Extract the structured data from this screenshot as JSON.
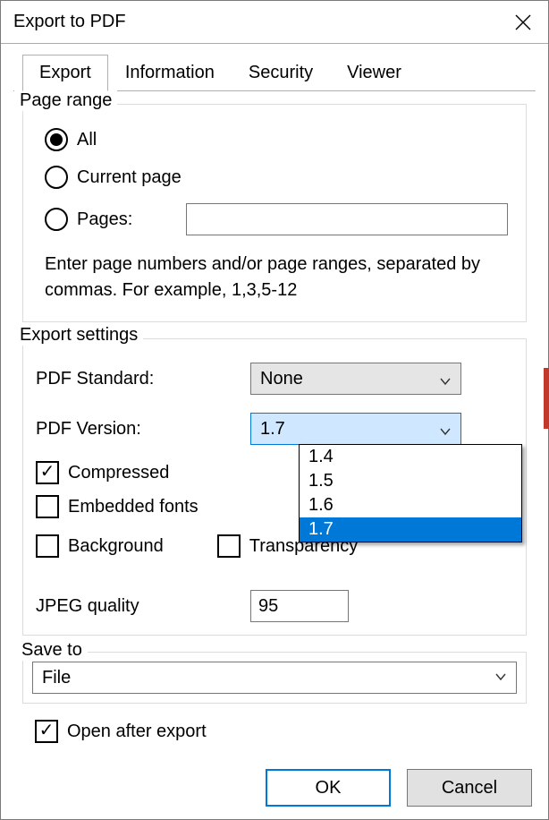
{
  "title": "Export to PDF",
  "tabs": [
    "Export",
    "Information",
    "Security",
    "Viewer"
  ],
  "activeTab": 0,
  "pageRange": {
    "title": "Page range",
    "options": {
      "all": "All",
      "current": "Current page",
      "pages": "Pages:"
    },
    "selected": "all",
    "pagesValue": "",
    "hint": "Enter page numbers and/or page ranges, separated by commas. For example, 1,3,5-12"
  },
  "exportSettings": {
    "title": "Export settings",
    "pdfStandardLabel": "PDF Standard:",
    "pdfStandardValue": "None",
    "pdfVersionLabel": "PDF Version:",
    "pdfVersionValue": "1.7",
    "pdfVersionOptions": [
      "1.4",
      "1.5",
      "1.6",
      "1.7"
    ],
    "pdfVersionOpen": true,
    "compressedLabel": "Compressed",
    "compressedChecked": true,
    "embeddedFontsLabel": "Embedded fonts",
    "embeddedFontsChecked": false,
    "backgroundLabel": "Background",
    "backgroundChecked": false,
    "transparencyLabel": "Transparency",
    "transparencyChecked": false,
    "jpegQualityLabel": "JPEG quality",
    "jpegQualityValue": "95"
  },
  "saveTo": {
    "title": "Save to",
    "value": "File"
  },
  "openAfter": {
    "label": "Open after export",
    "checked": true
  },
  "buttons": {
    "ok": "OK",
    "cancel": "Cancel"
  }
}
